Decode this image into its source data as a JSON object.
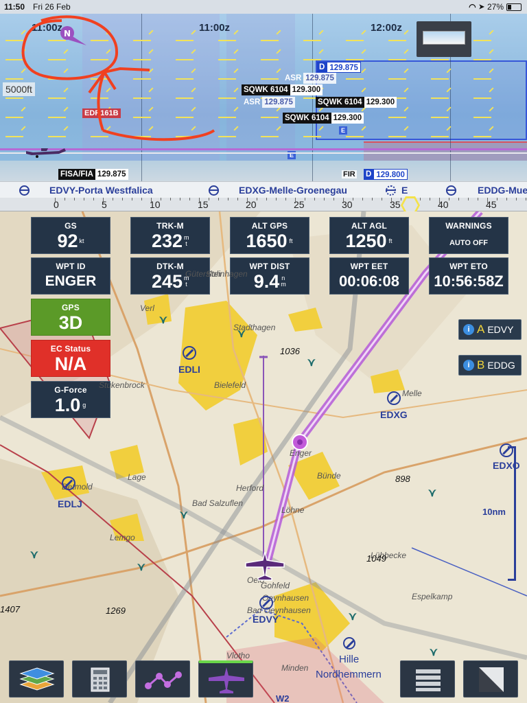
{
  "status_bar": {
    "time": "11:50",
    "date": "Fri 26 Feb",
    "battery": "27%"
  },
  "profile": {
    "times": [
      "11:00z",
      "11:00z",
      "12:00z"
    ],
    "altitude": "5000ft",
    "edr": "EDR161B",
    "tags": [
      {
        "key": "D",
        "value": "129.875",
        "style": "d"
      },
      {
        "key": "ASR",
        "value": "129.875",
        "style": "asr"
      },
      {
        "key": "SQWK 6104",
        "value": "129.300",
        "style": "dark"
      },
      {
        "key": "ASR",
        "value": "129.875",
        "style": "asr"
      },
      {
        "key": "SQWK 6104",
        "value": "129.300",
        "style": "dark"
      },
      {
        "key": "SQWK 6104",
        "value": "129.300",
        "style": "dark"
      },
      {
        "key": "FISA/FIA",
        "value": "129.875",
        "style": "dark"
      },
      {
        "key": "D",
        "value": "129.800",
        "style": "d"
      }
    ],
    "e_marks": [
      "E",
      "E",
      "E"
    ],
    "fir": "FIR"
  },
  "route": {
    "waypoints": [
      "EDVY-Porta Westfalica",
      "EDXG-Melle-Groenegau",
      "E",
      "EDDG-Mue"
    ],
    "ticks": [
      "0",
      "5",
      "10",
      "15",
      "20",
      "25",
      "30",
      "35",
      "40",
      "45"
    ]
  },
  "instruments": {
    "gs": {
      "label": "GS",
      "value": "92",
      "unit": "kt"
    },
    "trk": {
      "label": "TRK-M",
      "value": "232",
      "unit": "mt"
    },
    "alt_gps": {
      "label": "ALT GPS",
      "value": "1650",
      "unit": "ft"
    },
    "alt_agl": {
      "label": "ALT AGL",
      "value": "1250",
      "unit": "ft"
    },
    "warnings": {
      "label": "WARNINGS",
      "value": "AUTO OFF"
    },
    "wpt_id": {
      "label": "WPT ID",
      "value": "ENGER"
    },
    "dtk": {
      "label": "DTK-M",
      "value": "245",
      "unit": "mt"
    },
    "wpt_dist": {
      "label": "WPT DIST",
      "value": "9.4",
      "unit": "nm"
    },
    "wpt_eet": {
      "label": "WPT EET",
      "value": "00:06:08"
    },
    "wpt_eto": {
      "label": "WPT ETO",
      "value": "10:56:58Z"
    },
    "gps": {
      "label": "GPS",
      "value": "3D"
    },
    "ec": {
      "label": "EC Status",
      "value": "N/A"
    },
    "gforce": {
      "label": "G-Force",
      "value": "1.0",
      "unit": "g"
    }
  },
  "waypoint_buttons": [
    {
      "letter": "A",
      "code": "EDVY"
    },
    {
      "letter": "B",
      "code": "EDDG"
    }
  ],
  "map": {
    "towns": [
      "Verl",
      "Stukenbrock",
      "Bielefeld",
      "Lage",
      "Detmold",
      "Herford",
      "Bad Salzuflen",
      "Lemgo",
      "Enger",
      "Bünde",
      "Löhne",
      "Stadthagen",
      "Oelo",
      "Oeynhausen",
      "Gohfeld",
      "Espelkamp",
      "Lübbecke",
      "Melle",
      "Minden",
      "Vlotho",
      "Steinhagen",
      "Bad Oeynhausen",
      "Gütersloh"
    ],
    "airports": [
      "EDLI",
      "EDXG",
      "EDLJ",
      "EDVY",
      "EDXO"
    ],
    "elevations": [
      "1036",
      "898",
      "1049",
      "1269",
      "1407"
    ],
    "hille": "Hille",
    "nordhemmern": "Nordhemmern",
    "scale": "10nm",
    "w2": "W2"
  },
  "toolbar": {
    "items": [
      "layers",
      "calculator",
      "route",
      "aircraft",
      "menu",
      "split-screen"
    ]
  }
}
